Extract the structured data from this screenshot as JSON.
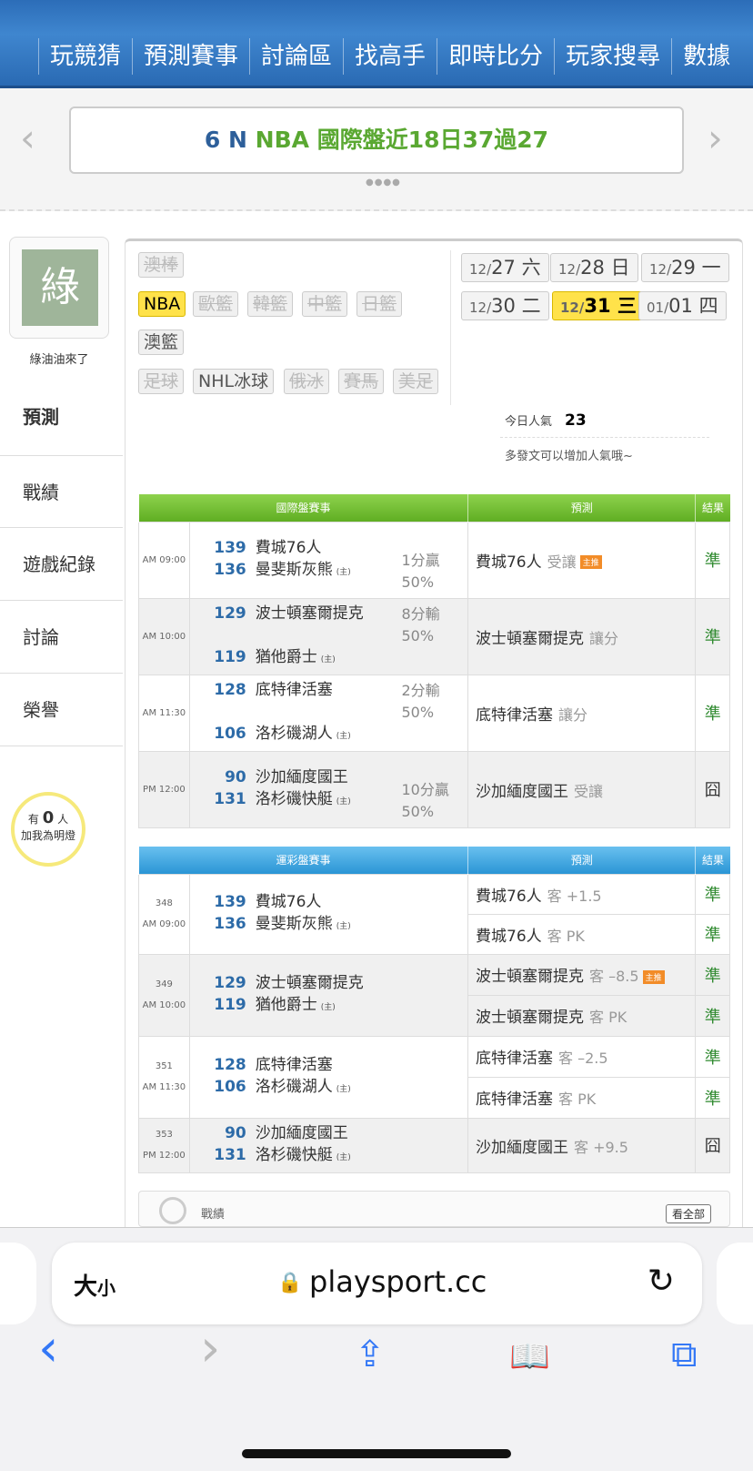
{
  "nav": [
    "玩競猜",
    "預測賽事",
    "討論區",
    "找高手",
    "即時比分",
    "玩家搜尋",
    "數據"
  ],
  "banner": {
    "prefix": "6 N",
    "text": "NBA 國際盤近18日37過27",
    "prev": "‹",
    "next": "›",
    "dots": "●●●●"
  },
  "profile": {
    "avatar_char": "綠",
    "name": "綠油油來了"
  },
  "sidebar": [
    "預測",
    "戰績",
    "遊戲紀錄",
    "討論",
    "榮譽"
  ],
  "bulb": {
    "pre": "有",
    "count": "0",
    "post": "人",
    "line2": "加我為明燈"
  },
  "sports_row1": [
    "澳棒"
  ],
  "sports_row2": [
    "NBA",
    "歐籃",
    "韓籃",
    "中籃",
    "日籃"
  ],
  "sports_row3": [
    "澳籃"
  ],
  "sports_row4": [
    "足球",
    "NHL冰球",
    "俄冰",
    "賽馬",
    "美足"
  ],
  "dates": [
    {
      "md": "12/",
      "d": "27",
      "w": "六"
    },
    {
      "md": "12/",
      "d": "28",
      "w": "日"
    },
    {
      "md": "12/",
      "d": "29",
      "w": "一"
    },
    {
      "md": "12/",
      "d": "30",
      "w": "二"
    },
    {
      "md": "12/",
      "d": "31",
      "w": "三"
    },
    {
      "md": "01/",
      "d": "01",
      "w": "四"
    }
  ],
  "popularity": {
    "label": "今日人氣",
    "value": "23",
    "hint": "多發文可以增加人氣哦~"
  },
  "intl": {
    "headers": [
      "國際盤賽事",
      "預測",
      "結果"
    ],
    "rows": [
      {
        "time": "AM 09:00",
        "s1": "139",
        "t1": "費城76人",
        "s2": "136",
        "t2": "曼斐斯灰熊",
        "home": "(主)",
        "sp1": "1分贏",
        "sp2": "50%",
        "pred": "費城76人",
        "pred_sub": "受讓",
        "badge": "主推",
        "res": "準"
      },
      {
        "time": "AM 10:00",
        "s1": "129",
        "t1": "波士頓塞爾提克",
        "s2": "119",
        "t2": "猶他爵士",
        "home": "(主)",
        "sp1": "8分輸",
        "sp2": "50%",
        "pred": "波士頓塞爾提克",
        "pred_sub": "讓分",
        "res": "準"
      },
      {
        "time": "AM 11:30",
        "s1": "128",
        "t1": "底特律活塞",
        "s2": "106",
        "t2": "洛杉磯湖人",
        "home": "(主)",
        "sp1": "2分輸",
        "sp2": "50%",
        "pred": "底特律活塞",
        "pred_sub": "讓分",
        "res": "準"
      },
      {
        "time": "PM 12:00",
        "s1": "90",
        "t1": "沙加緬度國王",
        "s2": "131",
        "t2": "洛杉磯快艇",
        "home": "(主)",
        "sp1": "10分贏",
        "sp2": "50%",
        "pred": "沙加緬度國王",
        "pred_sub": "受讓",
        "res": "囧"
      }
    ]
  },
  "lottery": {
    "headers": [
      "運彩盤賽事",
      "預測",
      "結果"
    ],
    "rows": [
      {
        "no": "348",
        "time": "AM 09:00",
        "s1": "139",
        "t1": "費城76人",
        "s2": "136",
        "t2": "曼斐斯灰熊",
        "home": "(主)",
        "p1": "費城76人",
        "p1s": "客 +1.5",
        "r1": "準",
        "p2": "費城76人",
        "p2s": "客 PK",
        "r2": "準"
      },
      {
        "no": "349",
        "time": "AM 10:00",
        "s1": "129",
        "t1": "波士頓塞爾提克",
        "s2": "119",
        "t2": "猶他爵士",
        "home": "(主)",
        "p1": "波士頓塞爾提克",
        "p1s": "客 –8.5",
        "badge": "主推",
        "r1": "準",
        "p2": "波士頓塞爾提克",
        "p2s": "客 PK",
        "r2": "準"
      },
      {
        "no": "351",
        "time": "AM 11:30",
        "s1": "128",
        "t1": "底特律活塞",
        "s2": "106",
        "t2": "洛杉磯湖人",
        "home": "(主)",
        "p1": "底特律活塞",
        "p1s": "客 –2.5",
        "r1": "準",
        "p2": "底特律活塞",
        "p2s": "客 PK",
        "r2": "準"
      },
      {
        "no": "353",
        "time": "PM 12:00",
        "s1": "90",
        "t1": "沙加緬度國王",
        "s2": "131",
        "t2": "洛杉磯快艇",
        "home": "(主)",
        "p1": "沙加緬度國王",
        "p1s": "客 +9.5",
        "r1": "囧"
      }
    ]
  },
  "record": {
    "label": "戰績",
    "button": "看全部"
  },
  "browser": {
    "aa_big": "大",
    "aa_small": "小",
    "host": "playsport.cc",
    "lock": "🔒",
    "reload": "↻"
  },
  "toolbar": {
    "back": "‹",
    "forward": "›",
    "share": "⇪",
    "books": "📖",
    "tabs": "⧉"
  }
}
